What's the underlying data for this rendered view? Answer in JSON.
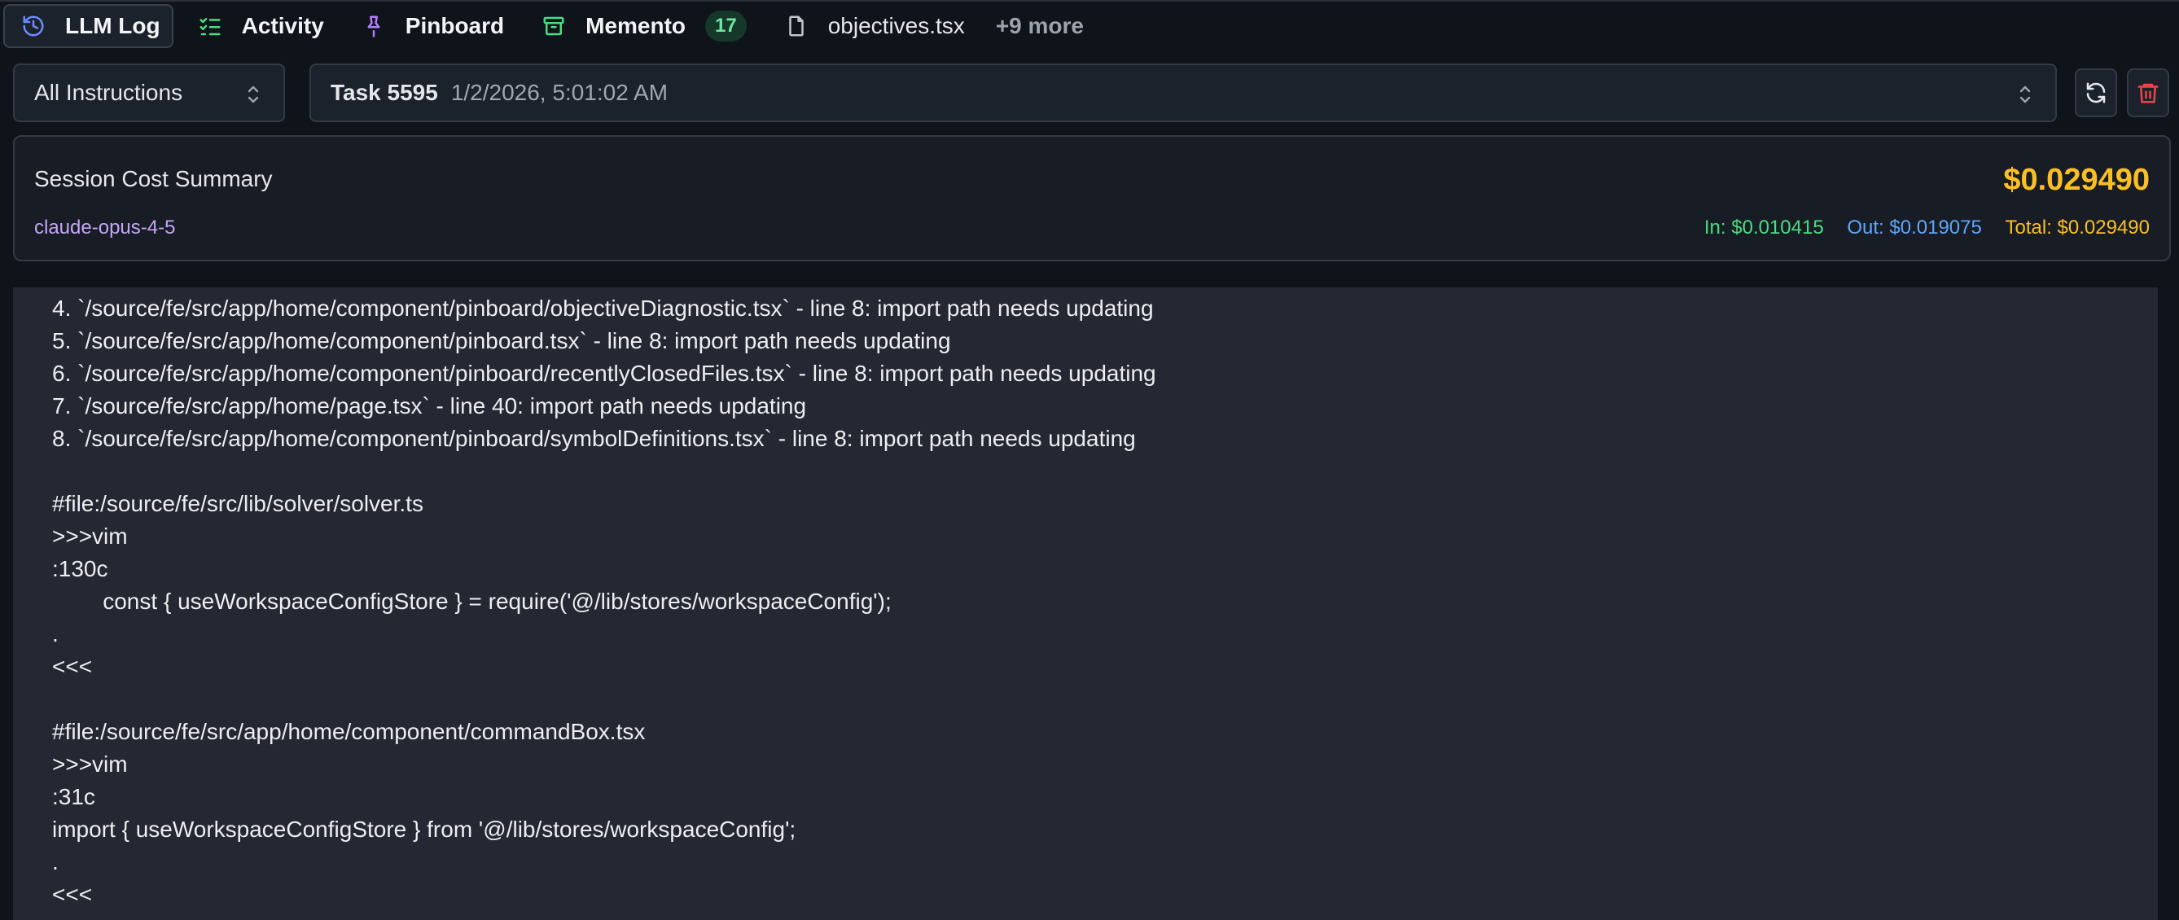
{
  "tabs": [
    {
      "label": "LLM Log",
      "icon": "history-icon",
      "active": true
    },
    {
      "label": "Activity",
      "icon": "checklist-icon"
    },
    {
      "label": "Pinboard",
      "icon": "pin-icon"
    },
    {
      "label": "Memento",
      "icon": "archive-icon",
      "badge": "17"
    },
    {
      "label": "objectives.tsx",
      "icon": "file-icon"
    }
  ],
  "more_tabs": "+9 more",
  "instruction_filter": {
    "value": "All Instructions"
  },
  "task_select": {
    "name": "Task 5595",
    "date": "1/2/2026, 5:01:02 AM"
  },
  "summary": {
    "title": "Session Cost Summary",
    "model": "claude-opus-4-5",
    "total_big": "$0.029490",
    "in": "In: $0.010415",
    "out": "Out: $0.019075",
    "total": "Total: $0.029490"
  },
  "log_lines": [
    "4. `/source/fe/src/app/home/component/pinboard/objectiveDiagnostic.tsx` - line 8: import path needs updating",
    "5. `/source/fe/src/app/home/component/pinboard.tsx` - line 8: import path needs updating",
    "6. `/source/fe/src/app/home/component/pinboard/recentlyClosedFiles.tsx` - line 8: import path needs updating",
    "7. `/source/fe/src/app/home/page.tsx` - line 40: import path needs updating",
    "8. `/source/fe/src/app/home/component/pinboard/symbolDefinitions.tsx` - line 8: import path needs updating",
    "",
    "#file:/source/fe/src/lib/solver/solver.ts",
    ">>>vim",
    ":130c",
    "        const { useWorkspaceConfigStore } = require('@/lib/stores/workspaceConfig');",
    ".",
    "<<<",
    "",
    "#file:/source/fe/src/app/home/component/commandBox.tsx",
    ">>>vim",
    ":31c",
    "import { useWorkspaceConfigStore } from '@/lib/stores/workspaceConfig';",
    ".",
    "<<<"
  ],
  "colors": {
    "accent_cost": "#fbbf24",
    "in_cost": "#4ade80",
    "out_cost": "#60a5fa",
    "model": "#c4a6f5",
    "badge_bg": "#16382a",
    "badge_fg": "#6ee7a1",
    "delete": "#ef4444"
  }
}
